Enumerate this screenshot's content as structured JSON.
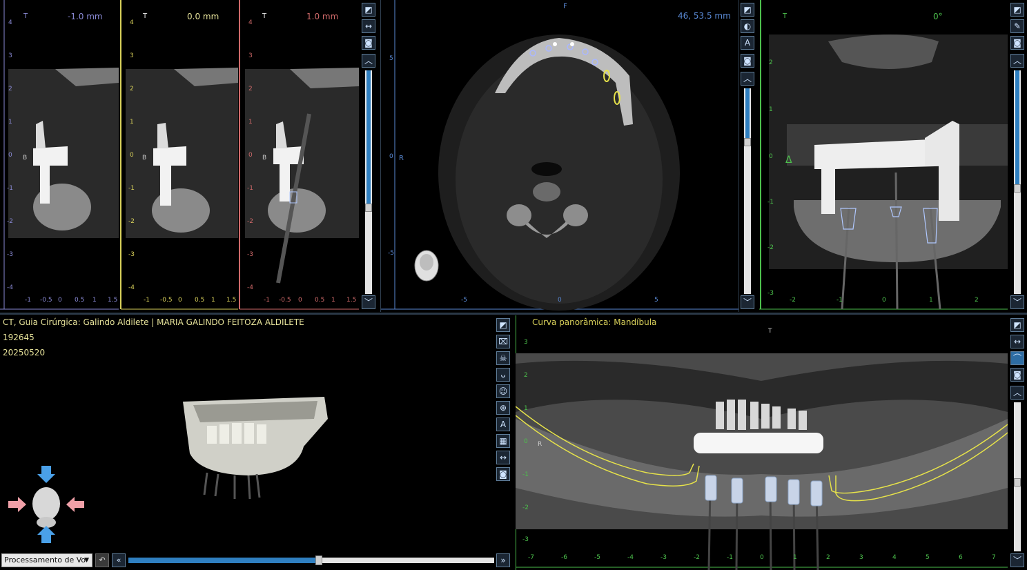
{
  "app": {
    "accent": "#2f7fc0",
    "colors": {
      "slice_minus": "#8a8ad6",
      "slice_zero": "#d8d05a",
      "slice_plus": "#d06a6a",
      "axial": "#5a8ad6",
      "coronal": "#4cc04c",
      "pano": "#d8d05a"
    }
  },
  "cross_sections": [
    {
      "orientation": "T",
      "offset": "-1.0 mm",
      "side": "B"
    },
    {
      "orientation": "T",
      "offset": "0.0 mm",
      "side": "B"
    },
    {
      "orientation": "T",
      "offset": "1.0 mm",
      "side": "B"
    }
  ],
  "cross_ruler": {
    "y_ticks": [
      "4",
      "3",
      "2",
      "1",
      "0",
      "-1",
      "-2",
      "-3",
      "-4"
    ],
    "x_ticks": [
      "-1",
      "-0.5",
      "0",
      "0.5",
      "1",
      "1.5"
    ]
  },
  "axial": {
    "top": "F",
    "left": "R",
    "dims": "46, 53.5 mm",
    "y_ticks": [
      "5",
      "0",
      "-5"
    ],
    "x_ticks": [
      "-5",
      "0",
      "5"
    ]
  },
  "coronal": {
    "orientation": "T",
    "angle": "0°",
    "delta": "Δ",
    "y_ticks": [
      "2",
      "1",
      "0",
      "-1",
      "-2",
      "-3"
    ],
    "x_ticks": [
      "-2",
      "-1",
      "0",
      "1",
      "2"
    ]
  },
  "info": {
    "line1": "CT, Guia Cirúrgica: Galindo Aldilete | MARIA GALINDO FEITOZA ALDILETE",
    "line2": "192645",
    "line3": "20250520"
  },
  "render3d": {
    "processing_select": "Processamento de Vo",
    "slider_value": 0.52
  },
  "panoramic": {
    "title": "Curva panorâmica: Mandíbula",
    "top": "T",
    "left": "R",
    "y_ticks": [
      "3",
      "2",
      "1",
      "0",
      "-1",
      "-2",
      "-3"
    ],
    "x_ticks": [
      "-7",
      "-6",
      "-5",
      "-4",
      "-3",
      "-2",
      "-1",
      "0",
      "1",
      "2",
      "3",
      "4",
      "5",
      "6",
      "7"
    ]
  },
  "scroll": {
    "cross_level": 0.62,
    "axial_level": 0.25,
    "coronal_level": 0.53,
    "pano_level": 0.54
  }
}
